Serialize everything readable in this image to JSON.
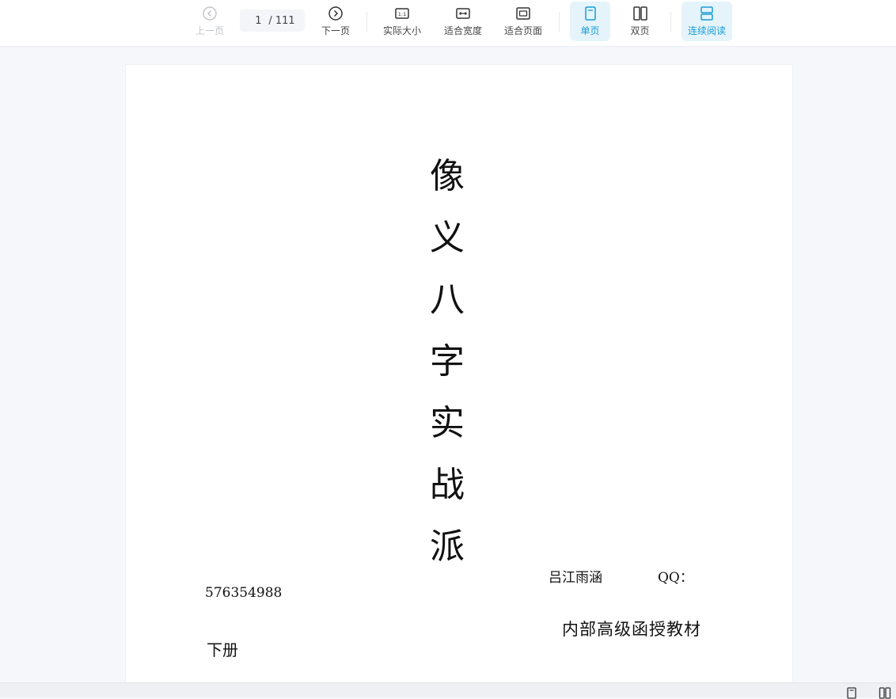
{
  "toolbar": {
    "prev_label": "上一页",
    "next_label": "下一页",
    "current_page": "1",
    "total_pages": "/ 111",
    "actual_size_label": "实际大小",
    "fit_width_label": "适合宽度",
    "fit_page_label": "适合页面",
    "single_page_label": "单页",
    "double_page_label": "双页",
    "continuous_label": "连续阅读",
    "accent_color": "#1a9bd7"
  },
  "document": {
    "title_chars": [
      "像",
      "义",
      "八",
      "字",
      "实",
      "战",
      "派"
    ],
    "author": "吕江雨涵",
    "qq_label": "QQ：",
    "qq_number": "576354988",
    "subtitle": "内部高级函授教材",
    "volume": "下册"
  }
}
